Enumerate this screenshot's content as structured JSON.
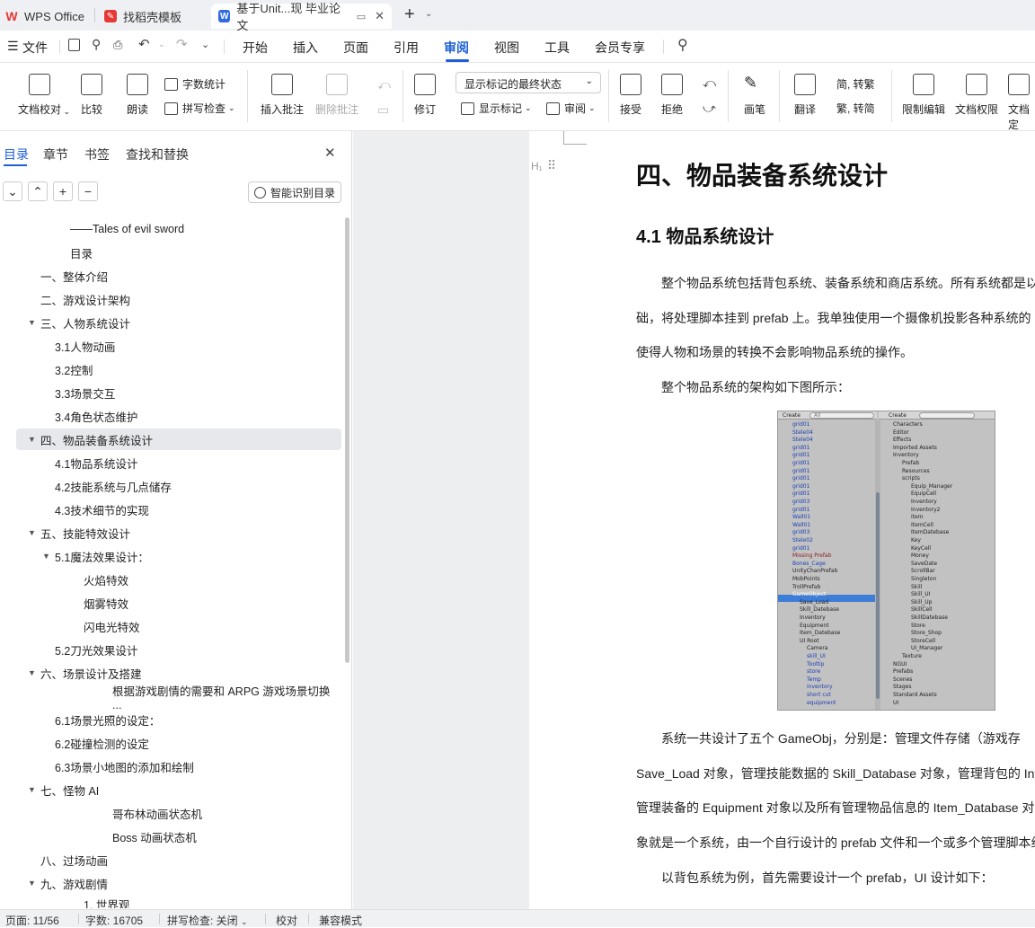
{
  "tabs": {
    "t1": "WPS Office",
    "t2": "找稻壳模板",
    "t3": "基于Unit...现 毕业论文"
  },
  "menu": {
    "file": "文件",
    "items": [
      "开始",
      "插入",
      "页面",
      "引用",
      "审阅",
      "视图",
      "工具",
      "会员专享"
    ]
  },
  "ribbon": {
    "proof": "文档校对",
    "compare": "比较",
    "read": "朗读",
    "wordcount": "字数统计",
    "spell": "拼写检查",
    "insert_comment": "插入批注",
    "delete_comment": "删除批注",
    "revise": "修订",
    "display_state": "显示标记的最终状态",
    "show_marks": "显示标记",
    "review": "审阅",
    "accept": "接受",
    "reject": "拒绝",
    "pen": "画笔",
    "translate": "翻译",
    "to_trad": "简, 转繁",
    "to_simp": "繁, 转简",
    "restrict": "限制编辑",
    "perm": "文档权限",
    "more": "文档定"
  },
  "nav": {
    "tabs": [
      "目录",
      "章节",
      "书签",
      "查找和替换"
    ],
    "smart_btn": "智能识别目录",
    "toc": [
      {
        "t": "——Tales of evil sword"
      },
      {
        "t": "目录"
      },
      {
        "t": "一、整体介绍"
      },
      {
        "t": "二、游戏设计架构"
      },
      {
        "t": "三、人物系统设计"
      },
      {
        "t": "3.1人物动画"
      },
      {
        "t": "3.2控制"
      },
      {
        "t": "3.3场景交互"
      },
      {
        "t": "3.4角色状态维护"
      },
      {
        "t": "四、物品装备系统设计"
      },
      {
        "t": "4.1物品系统设计"
      },
      {
        "t": "4.2技能系统与几点储存"
      },
      {
        "t": "4.3技术细节的实现"
      },
      {
        "t": "五、技能特效设计"
      },
      {
        "t": "5.1魔法效果设计："
      },
      {
        "t": "火焰特效"
      },
      {
        "t": "烟雾特效"
      },
      {
        "t": "闪电光特效"
      },
      {
        "t": "5.2刀光效果设计"
      },
      {
        "t": "六、场景设计及搭建"
      },
      {
        "t": "根据游戏剧情的需要和 ARPG 游戏场景切换 ..."
      },
      {
        "t": "6.1场景光照的设定："
      },
      {
        "t": "6.2碰撞检测的设定"
      },
      {
        "t": "6.3场景小地图的添加和绘制"
      },
      {
        "t": "七、怪物 AI"
      },
      {
        "t": "哥布林动画状态机"
      },
      {
        "t": "Boss 动画状态机"
      },
      {
        "t": "八、过场动画"
      },
      {
        "t": "九、游戏剧情"
      },
      {
        "t": "1. 世界观"
      }
    ]
  },
  "doc": {
    "h1": "四、物品装备系统设计",
    "h2": "4.1  物品系统设计",
    "p1": "整个物品系统包括背包系统、装备系统和商店系统。所有系统都是以一个",
    "p2": "础，将处理脚本挂到 prefab 上。我单独使用一个摄像机投影各种系统的",
    "p3": "使得人物和场景的转换不会影响物品系统的操作。",
    "p4": "整个物品系统的架构如下图所示：",
    "p5": "系统一共设计了五个 GameObj，分别是：管理文件存储（游戏存",
    "p6": "Save_Load 对象，管理技能数据的 Skill_Database 对象，管理背包的 Inve",
    "p7": "管理装备的 Equipment 对象以及所有管理物品信息的 Item_Database 对",
    "p8": "象就是一个系统，由一个自行设计的 prefab 文件和一个或多个管理脚本组",
    "p9": "以背包系统为例，首先需要设计一个 prefab，UI 设计如下："
  },
  "unity": {
    "create": "Create",
    "search": "All",
    "left": [
      "grid01",
      "Stele04",
      "Stele04",
      "grid01",
      "grid01",
      "grid01",
      "grid01",
      "grid01",
      "grid01",
      "grid01",
      "grid03",
      "grid01",
      "Wall01",
      "Wall01",
      "grid03",
      "Stele02",
      "grid01",
      "Missing Prefab",
      "Bones_Cage",
      "UnityChanPrefab",
      "MobPoints",
      "TrollPrefab",
      "GameObject",
      "Save_Load",
      "Skill_Datebase",
      "Inventory",
      "Equipment",
      "Item_Datebase",
      "UI Root",
      "Camera",
      "skill_UI",
      "Tooltip",
      "store",
      "Temp",
      "inventory",
      "short cut",
      "equipment"
    ],
    "right": [
      "Characters",
      "Editor",
      "Effects",
      "Imported Assets",
      "Inventory",
      "Prefab",
      "Resources",
      "scripts",
      "Equip_Manager",
      "EquipCell",
      "Inventory",
      "Inventory2",
      "item",
      "ItemCell",
      "ItemDatebase",
      "Key",
      "KeyCell",
      "Money",
      "SaveDate",
      "ScrollBar",
      "Singleton",
      "Skill",
      "Skill_UI",
      "Skill_Up",
      "SkillCell",
      "SkillDatebase",
      "Store",
      "Store_Shop",
      "StoreCell",
      "UI_Manager",
      "Texture",
      "NGUI",
      "Prefabs",
      "Scenes",
      "Stages",
      "Standard Assets",
      "UI"
    ]
  },
  "status": {
    "page": "页面: 11/56",
    "words": "字数: 16705",
    "spell": "拼写检查: 关闭",
    "proof": "校对",
    "compat": "兼容模式"
  }
}
